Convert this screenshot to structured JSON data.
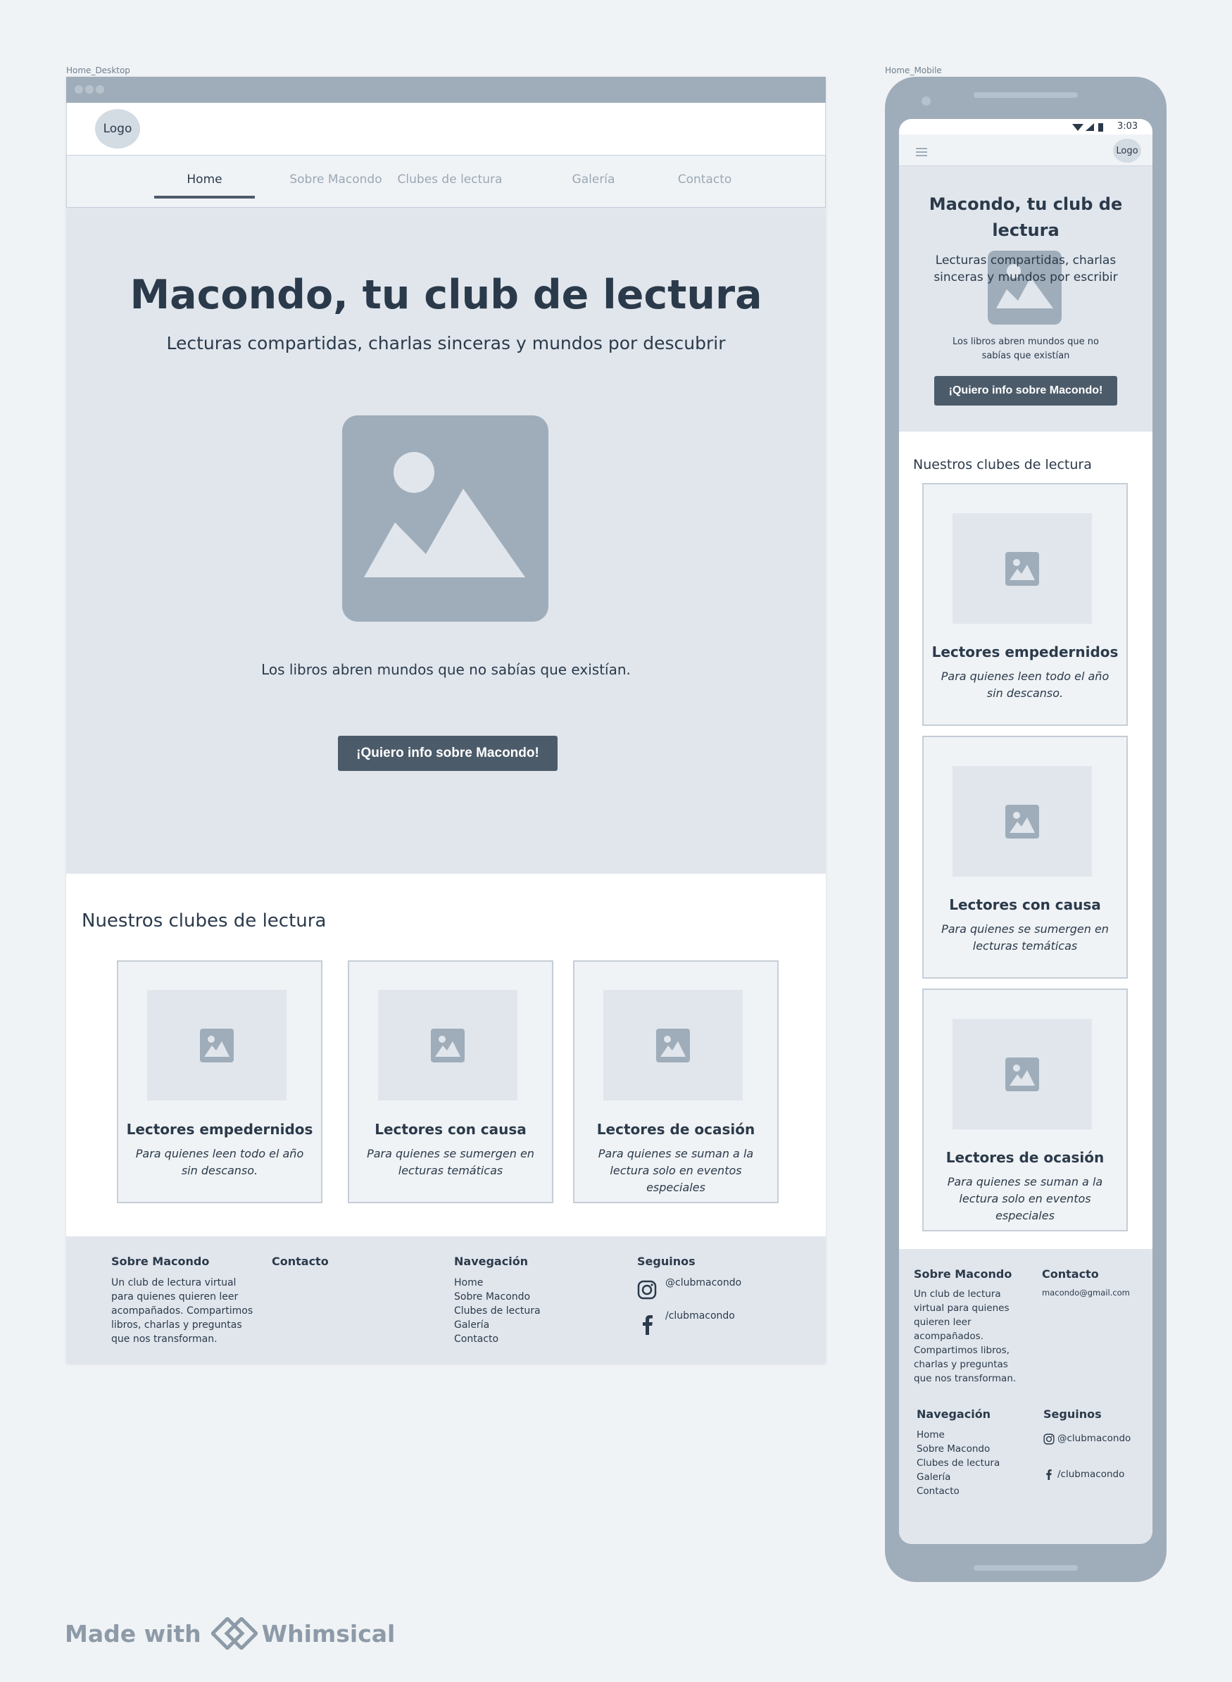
{
  "labels": {
    "desktop": "Home_Desktop",
    "mobile": "Home_Mobile"
  },
  "site": {
    "logo": "Logo",
    "nav": [
      "Home",
      "Sobre Macondo",
      "Clubes de lectura",
      "Galería",
      "Contacto"
    ],
    "active_nav": "Home"
  },
  "hero": {
    "title": "Macondo, tu club de lectura",
    "subtitle": "Lecturas compartidas, charlas sinceras y mundos por descubrir",
    "caption": "Los libros abren mundos que no sabías que existían.",
    "cta": "¡Quiero info sobre Macondo!"
  },
  "mobile_hero": {
    "title": "Macondo, tu club de lectura",
    "subtitle": "Lecturas compartidas, charlas sinceras y mundos por escribir",
    "caption": "Los libros abren mundos que no sabías que existían",
    "cta": "¡Quiero info sobre Macondo!"
  },
  "clubs": {
    "title": "Nuestros clubes de lectura",
    "items": [
      {
        "title": "Lectores empedernidos",
        "desc": "Para quienes leen todo el año sin descanso."
      },
      {
        "title": "Lectores con causa",
        "desc": "Para quienes se sumergen en lecturas temáticas"
      },
      {
        "title": "Lectores de ocasión",
        "desc": "Para quienes se suman a la lectura solo en eventos especiales"
      }
    ]
  },
  "footer": {
    "about_title": "Sobre Macondo",
    "about_text": "Un club de lectura virtual para quienes quieren leer acompañados. Compartimos libros, charlas y preguntas que nos transforman.",
    "contact_title": "Contacto",
    "contact_email": "macondo@gmail.com",
    "nav_title": "Navegación",
    "nav_links": [
      "Home",
      "Sobre Macondo",
      "Clubes de lectura",
      "Galería",
      "Contacto"
    ],
    "social_title": "Seguinos",
    "instagram": "@clubmacondo",
    "facebook": "/clubmacondo"
  },
  "status_bar": {
    "time": "3:03"
  },
  "branding": {
    "made_with": "Made with",
    "brand": "Whimsical"
  },
  "colors": {
    "primary_button": "#4c5b6a",
    "hero_bg": "#e1e6ed",
    "placeholder": "#9fadba"
  }
}
